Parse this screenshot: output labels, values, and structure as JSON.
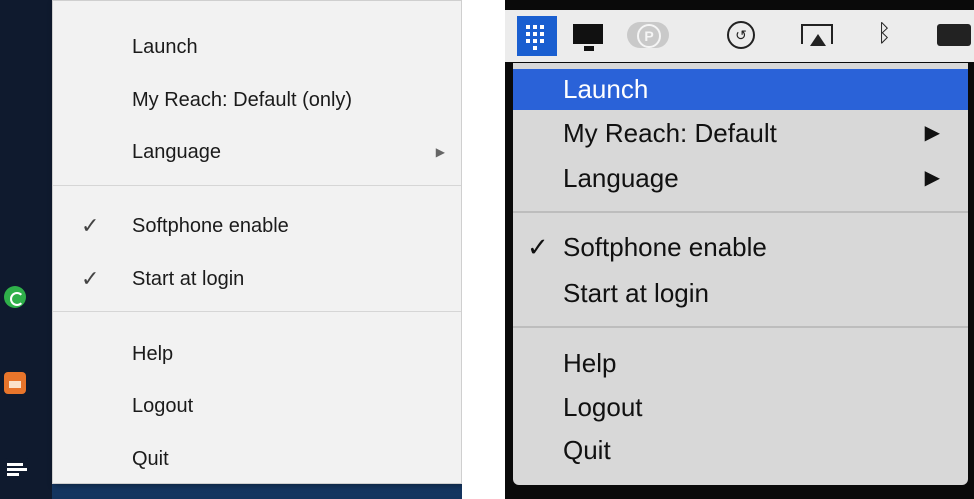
{
  "windows_menu": {
    "items": [
      {
        "label": "Launch",
        "checked": false,
        "submenu": false
      },
      {
        "label": "My Reach: Default (only)",
        "checked": false,
        "submenu": false
      },
      {
        "label": "Language",
        "checked": false,
        "submenu": true
      },
      {
        "label": "Softphone enable",
        "checked": true,
        "submenu": false
      },
      {
        "label": "Start at login",
        "checked": true,
        "submenu": false
      },
      {
        "label": "Help",
        "checked": false,
        "submenu": false
      },
      {
        "label": "Logout",
        "checked": false,
        "submenu": false
      },
      {
        "label": "Quit",
        "checked": false,
        "submenu": false
      }
    ],
    "check_glyph": "✓",
    "submenu_glyph": "▶"
  },
  "mac_menu": {
    "items": [
      {
        "label": "Launch",
        "checked": false,
        "submenu": false,
        "highlighted": true
      },
      {
        "label": "My Reach: Default",
        "checked": false,
        "submenu": true
      },
      {
        "label": "Language",
        "checked": false,
        "submenu": true
      },
      {
        "label": "Softphone enable",
        "checked": true,
        "submenu": false
      },
      {
        "label": "Start at login",
        "checked": false,
        "submenu": false
      },
      {
        "label": "Help",
        "checked": false,
        "submenu": false
      },
      {
        "label": "Logout",
        "checked": false,
        "submenu": false
      },
      {
        "label": "Quit",
        "checked": false,
        "submenu": false
      }
    ],
    "check_glyph": "✓",
    "submenu_glyph": "▶"
  },
  "mac_menubar": {
    "icons": [
      "app-grid-icon",
      "monitor-icon",
      "cloud-p-icon",
      "time-machine-icon",
      "airplay-icon",
      "bluetooth-icon",
      "battery-icon"
    ],
    "bluetooth_glyph": "ᛒ",
    "clock_glyph": "↺"
  },
  "colors": {
    "mac_highlight": "#2a62d8",
    "win_menu_bg": "#f2f2f2",
    "mac_menu_bg": "#d8d8d8"
  }
}
